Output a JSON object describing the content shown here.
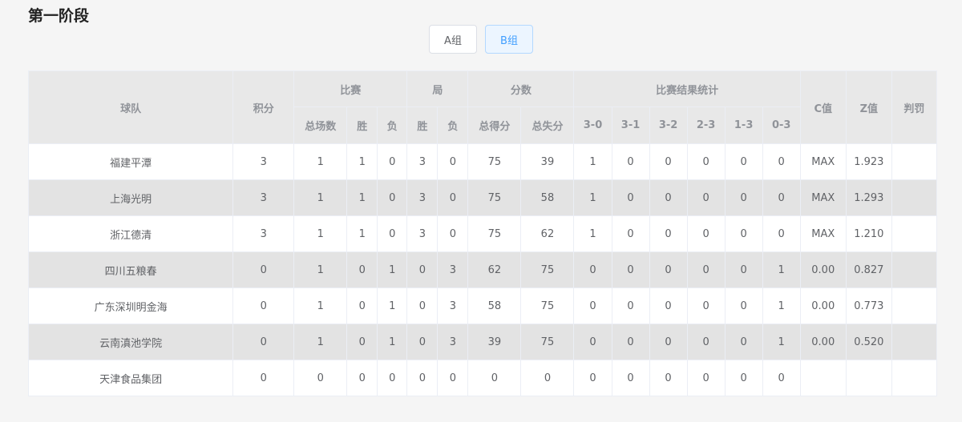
{
  "page": {
    "title": "第一阶段"
  },
  "tabs": [
    {
      "label": "A组",
      "active": false
    },
    {
      "label": "B组",
      "active": true
    }
  ],
  "table": {
    "headers": {
      "team": "球队",
      "points": "积分",
      "matches": "比赛",
      "sets": "局",
      "scores": "分数",
      "results": "比赛结果统计",
      "c_value": "C值",
      "z_value": "Z值",
      "penalty": "判罚",
      "total_matches": "总场数",
      "match_win": "胜",
      "match_loss": "负",
      "set_win": "胜",
      "set_loss": "负",
      "points_won": "总得分",
      "points_lost": "总失分",
      "r30": "3-0",
      "r31": "3-1",
      "r32": "3-2",
      "r23": "2-3",
      "r13": "1-3",
      "r03": "0-3"
    },
    "rows": [
      [
        "福建平潭",
        "3",
        "1",
        "1",
        "0",
        "3",
        "0",
        "75",
        "39",
        "1",
        "0",
        "0",
        "0",
        "0",
        "0",
        "MAX",
        "1.923",
        ""
      ],
      [
        "上海光明",
        "3",
        "1",
        "1",
        "0",
        "3",
        "0",
        "75",
        "58",
        "1",
        "0",
        "0",
        "0",
        "0",
        "0",
        "MAX",
        "1.293",
        ""
      ],
      [
        "浙江德清",
        "3",
        "1",
        "1",
        "0",
        "3",
        "0",
        "75",
        "62",
        "1",
        "0",
        "0",
        "0",
        "0",
        "0",
        "MAX",
        "1.210",
        ""
      ],
      [
        "四川五粮春",
        "0",
        "1",
        "0",
        "1",
        "0",
        "3",
        "62",
        "75",
        "0",
        "0",
        "0",
        "0",
        "0",
        "1",
        "0.00",
        "0.827",
        ""
      ],
      [
        "广东深圳明金海",
        "0",
        "1",
        "0",
        "1",
        "0",
        "3",
        "58",
        "75",
        "0",
        "0",
        "0",
        "0",
        "0",
        "1",
        "0.00",
        "0.773",
        ""
      ],
      [
        "云南滇池学院",
        "0",
        "1",
        "0",
        "1",
        "0",
        "3",
        "39",
        "75",
        "0",
        "0",
        "0",
        "0",
        "0",
        "1",
        "0.00",
        "0.520",
        ""
      ],
      [
        "天津食品集团",
        "0",
        "0",
        "0",
        "0",
        "0",
        "0",
        "0",
        "0",
        "0",
        "0",
        "0",
        "0",
        "0",
        "0",
        "",
        "",
        ""
      ]
    ]
  }
}
